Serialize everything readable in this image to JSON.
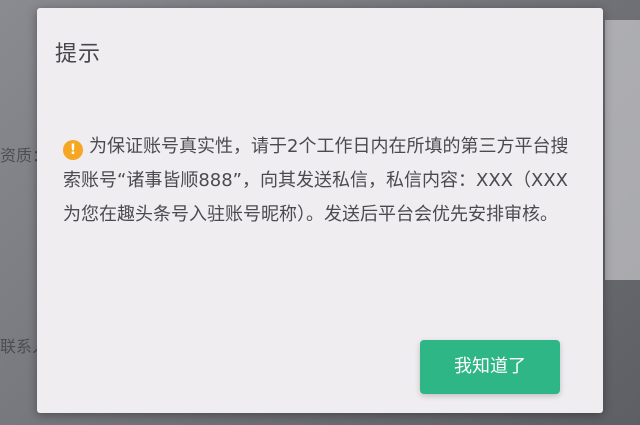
{
  "background": {
    "left_labels": [
      "资质：",
      "联系人"
    ]
  },
  "dialog": {
    "title": "提示",
    "icon": "warning-icon",
    "icon_glyph": "!",
    "message": "为保证账号真实性，请于2个工作日内在所填的第三方平台搜索账号“诸事皆顺888”，向其发送私信，私信内容：XXX（XXX为您在趣头条号入驻账号昵称）。发送后平台会优先安排审核。",
    "confirm_label": "我知道了"
  },
  "colors": {
    "accent": "#2fb686",
    "warning": "#f5a623"
  }
}
